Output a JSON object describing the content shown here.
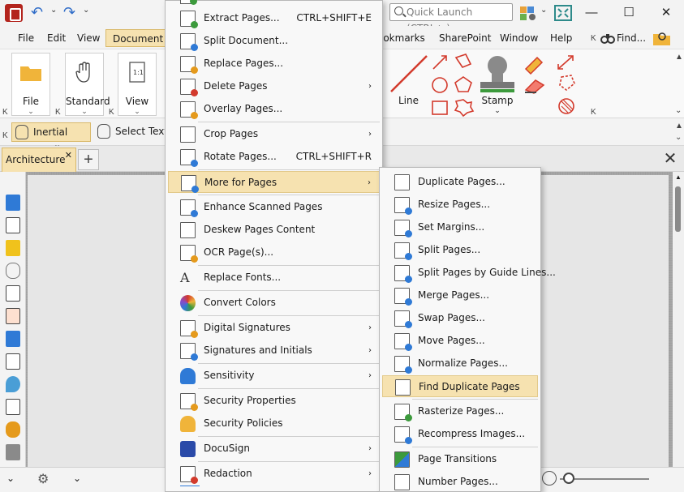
{
  "window": {
    "quick_launch_placeholder": "Quick Launch (CTRL+.)",
    "minimize": "—",
    "maximize": "☐",
    "close": "✕"
  },
  "menubar": {
    "items": [
      "File",
      "Edit",
      "View",
      "Document",
      "ookmarks",
      "SharePoint",
      "Window",
      "Help"
    ],
    "find_label": "Find..."
  },
  "ribbon": {
    "file_label": "File",
    "standard_label": "Standard",
    "view_label": "View",
    "line_label": "Line",
    "stamp_label": "Stamp"
  },
  "toolbar": {
    "inertial_scroll": "Inertial Scroll",
    "select_text": "Select Text/"
  },
  "tabs": {
    "doc_tab_label": "Architecture",
    "add_tab": "+",
    "close_doc": "✕"
  },
  "menu1": {
    "items": [
      {
        "label": "Extract Pages...",
        "shortcut": "CTRL+SHIFT+E",
        "submenu": false
      },
      {
        "label": "Split Document...",
        "shortcut": "",
        "submenu": false
      },
      {
        "label": "Replace Pages...",
        "shortcut": "",
        "submenu": false
      },
      {
        "label": "Delete Pages",
        "shortcut": "",
        "submenu": true
      },
      {
        "label": "Overlay Pages...",
        "shortcut": "",
        "submenu": false
      },
      {
        "label": "Crop Pages",
        "shortcut": "",
        "submenu": true
      },
      {
        "label": "Rotate Pages...",
        "shortcut": "CTRL+SHIFT+R",
        "submenu": false
      },
      {
        "label": "More for Pages",
        "shortcut": "",
        "submenu": true
      },
      {
        "label": "Enhance Scanned Pages",
        "shortcut": "",
        "submenu": false
      },
      {
        "label": "Deskew Pages Content",
        "shortcut": "",
        "submenu": false
      },
      {
        "label": "OCR Page(s)...",
        "shortcut": "",
        "submenu": false
      },
      {
        "label": "Replace Fonts...",
        "shortcut": "",
        "submenu": false
      },
      {
        "label": "Convert Colors",
        "shortcut": "",
        "submenu": false
      },
      {
        "label": "Digital Signatures",
        "shortcut": "",
        "submenu": true
      },
      {
        "label": "Signatures and Initials",
        "shortcut": "",
        "submenu": true
      },
      {
        "label": "Sensitivity",
        "shortcut": "",
        "submenu": true
      },
      {
        "label": "Security Properties",
        "shortcut": "",
        "submenu": false
      },
      {
        "label": "Security Policies",
        "shortcut": "",
        "submenu": false
      },
      {
        "label": "DocuSign",
        "shortcut": "",
        "submenu": true
      },
      {
        "label": "Redaction",
        "shortcut": "",
        "submenu": true
      }
    ],
    "submenu_arrow": "›"
  },
  "menu2": {
    "items": [
      {
        "label": "Duplicate Pages..."
      },
      {
        "label": "Resize Pages..."
      },
      {
        "label": "Set Margins..."
      },
      {
        "label": "Split Pages..."
      },
      {
        "label": "Split Pages by Guide Lines..."
      },
      {
        "label": "Merge Pages..."
      },
      {
        "label": "Swap Pages..."
      },
      {
        "label": "Move Pages..."
      },
      {
        "label": "Normalize Pages..."
      },
      {
        "label": "Find Duplicate Pages"
      },
      {
        "label": "Rasterize Pages..."
      },
      {
        "label": "Recompress Images..."
      },
      {
        "label": "Page Transitions"
      },
      {
        "label": "Number Pages..."
      }
    ]
  },
  "colors": {
    "highlight": "#f6e2b0",
    "highlight_border": "#d9b96a",
    "accent_red": "#d33a2c",
    "accent_blue": "#2f7ad6"
  }
}
